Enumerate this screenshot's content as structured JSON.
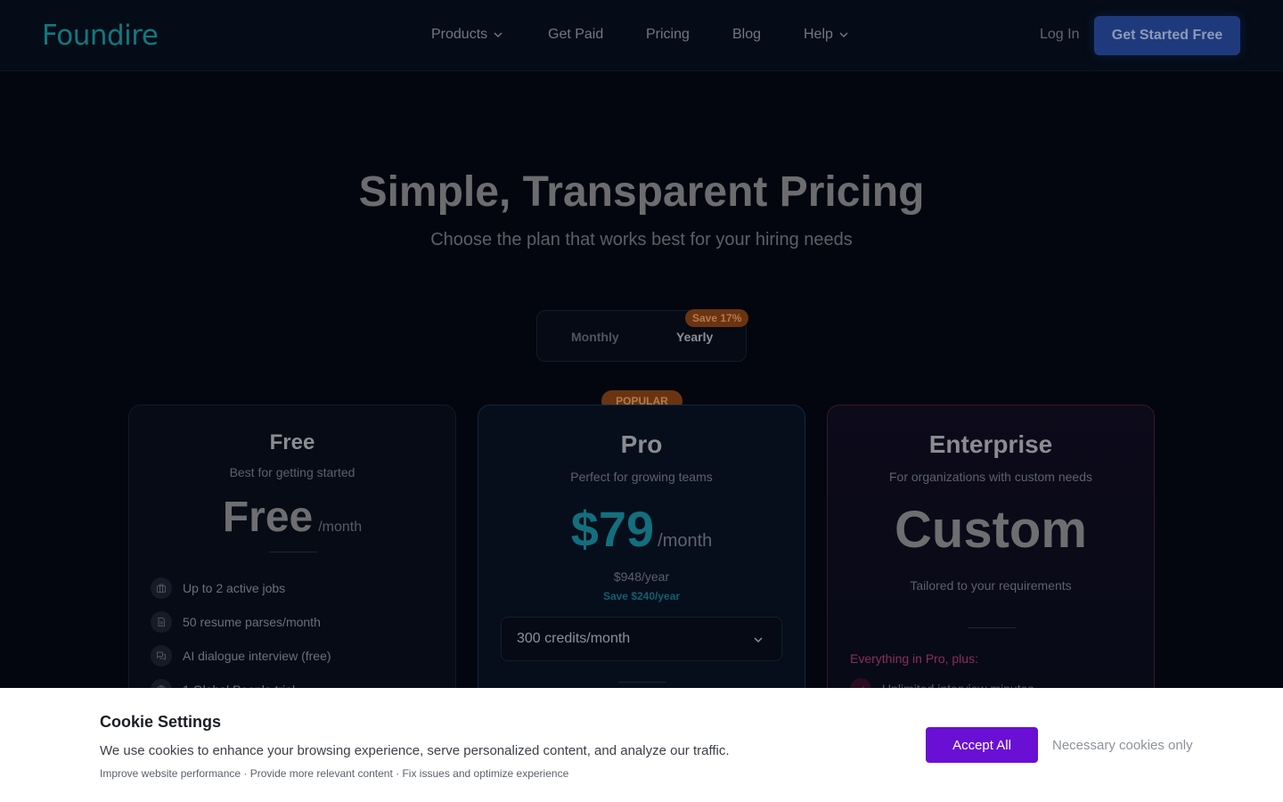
{
  "brand": {
    "logo": "Foundire"
  },
  "nav": {
    "items": [
      {
        "label": "Products",
        "has_dropdown": true
      },
      {
        "label": "Get Paid",
        "has_dropdown": false
      },
      {
        "label": "Pricing",
        "has_dropdown": false
      },
      {
        "label": "Blog",
        "has_dropdown": false
      },
      {
        "label": "Help",
        "has_dropdown": true
      }
    ],
    "login": "Log In",
    "cta": "Get Started Free"
  },
  "hero": {
    "title": "Simple, Transparent Pricing",
    "subtitle": "Choose the plan that works best for your hiring needs"
  },
  "billing_toggle": {
    "monthly": "Monthly",
    "yearly": "Yearly",
    "selected": "Yearly",
    "save_badge": "Save 17%"
  },
  "plans": {
    "free": {
      "name": "Free",
      "tagline": "Best for getting started",
      "price": "Free",
      "period": "/month",
      "features": [
        {
          "icon": "briefcase-icon",
          "text": "Up to 2 active jobs"
        },
        {
          "icon": "document-icon",
          "text": "50 resume parses/month"
        },
        {
          "icon": "chat-icon",
          "text": "AI dialogue interview (free)"
        },
        {
          "icon": "globe-icon",
          "text": "1 Global People trial"
        }
      ]
    },
    "pro": {
      "badge": "POPULAR",
      "name": "Pro",
      "tagline": "Perfect for growing teams",
      "price": "$79",
      "period": "/month",
      "yearly_price": "$948/year",
      "yearly_save": "Save $240/year",
      "credits_selected": "300 credits/month"
    },
    "enterprise": {
      "name": "Enterprise",
      "tagline": "For organizations with custom needs",
      "price": "Custom",
      "price_note": "Tailored to your requirements",
      "includes_heading": "Everything in Pro, plus:",
      "features": [
        {
          "icon": "check-icon",
          "text": "Unlimited interview minutes"
        }
      ]
    }
  },
  "cookie": {
    "title": "Cookie Settings",
    "body": "We use cookies to enhance your browsing experience, serve personalized content, and analyze our traffic.",
    "details": "Improve website performance · Provide more relevant content · Fix issues and optimize experience",
    "accept": "Accept All",
    "necessary": "Necessary cookies only"
  },
  "colors": {
    "accent_teal": "#11787f",
    "cta_blue": "#1f3a7c",
    "popular_orange": "#6a3412",
    "enterprise_pink": "#8a2e5a",
    "accept_purple": "#6a0fd4"
  }
}
